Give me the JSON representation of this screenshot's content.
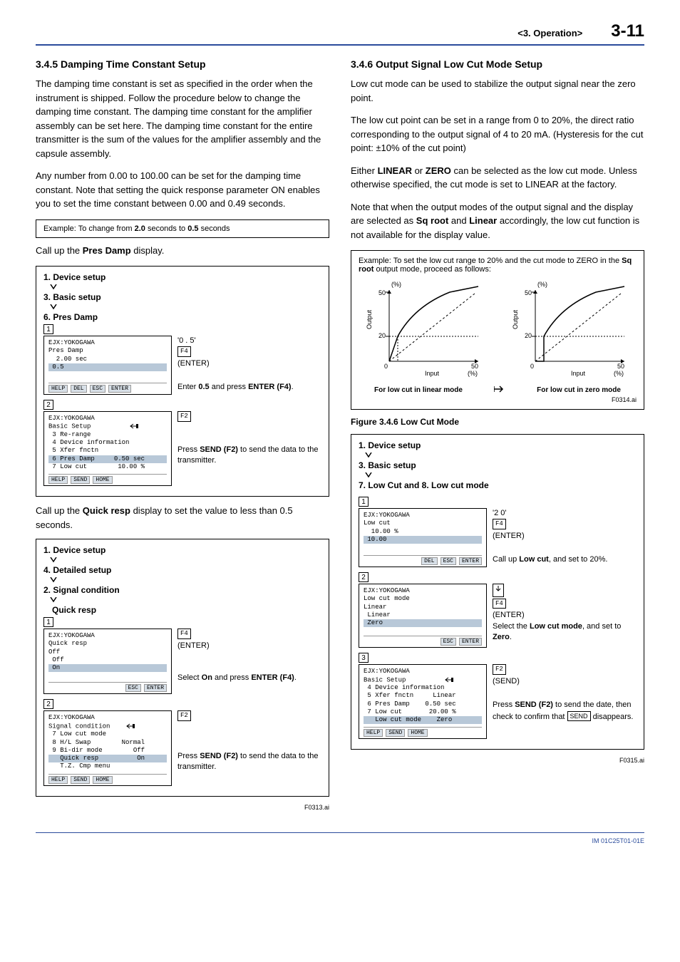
{
  "header": {
    "section": "<3.  Operation>",
    "page": "3-11"
  },
  "left": {
    "h345": "3.4.5   Damping Time Constant Setup",
    "p1": "The damping time constant is set as specified in the order when the instrument is shipped. Follow the procedure below to change the damping time constant. The damping time constant for the amplifier assembly can be set here. The damping time constant for the entire transmitter is the sum of the values for the amplifier assembly and the capsule assembly.",
    "p2": "Any number from 0.00 to 100.00 can be set for the damping time constant. Note that setting the quick response parameter ON enables you to set the time constant between 0.00 and 0.49 seconds.",
    "ex1_pre": "Example:  To change from ",
    "ex1_b1": "2.0",
    "ex1_mid": " seconds to ",
    "ex1_b2": "0.5",
    "ex1_post": " seconds",
    "callup1_a": "Call up the ",
    "callup1_b": "Pres Damp",
    "callup1_c": " display.",
    "menu1_1": "1. Device setup",
    "menu1_2": "3. Basic setup",
    "menu1_3": "6. Pres Damp",
    "t1_l1": "EJX:YOKOGAWA",
    "t1_l2": "Pres Damp",
    "t1_l3": "  2.00 sec",
    "t1_l4": " 0.5",
    "tb_help": "HELP",
    "tb_del": "DEL",
    "tb_esc": "ESC",
    "tb_enter": "ENTER",
    "ins1_val": "'0 . 5'",
    "ins1_key": "F4",
    "ins1_enter": "(ENTER)",
    "ins1_txt_a": "Enter ",
    "ins1_txt_b": "0.5",
    "ins1_txt_c": " and press ",
    "ins1_txt_d": "ENTER (F4)",
    "ins1_txt_e": ".",
    "t2_l1": "EJX:YOKOGAWA",
    "t2_l2": "Basic Setup",
    "t2_l3": " 3 Re-range",
    "t2_l4": " 4 Device information",
    "t2_l5": " 5 Xfer fnctn",
    "t2_l6": " 6 Pres Damp     0.50 sec",
    "t2_l7": " 7 Low cut        10.00 %",
    "tb_send": "SEND",
    "tb_home": "HOME",
    "ins2_key": "F2",
    "ins2_txt_a": "Press ",
    "ins2_txt_b": "SEND (F2)",
    "ins2_txt_c": " to send the data to the transmitter.",
    "callup2_a": "Call up the ",
    "callup2_b": "Quick resp",
    "callup2_c": " display to set the value to less than 0.5 seconds.",
    "menu2_1": "1. Device setup",
    "menu2_2": "4. Detailed setup",
    "menu2_3": "2. Signal condition",
    "menu2_4": "Quick resp",
    "t3_l1": "EJX:YOKOGAWA",
    "t3_l2": "Quick resp",
    "t3_l3": "Off",
    "t3_l4": " Off",
    "t3_l5": " On",
    "ins3_key": "F4",
    "ins3_enter": "(ENTER)",
    "ins3_txt_a": "Select ",
    "ins3_txt_b": "On",
    "ins3_txt_c": " and press ",
    "ins3_txt_d": "ENTER (F4)",
    "ins3_txt_e": ".",
    "t4_l1": "EJX:YOKOGAWA",
    "t4_l2": "Signal condition",
    "t4_l3": " 7 Low cut mode",
    "t4_l4": " 8 H/L Swap        Normal",
    "t4_l5": " 9 Bi-dir mode        Off",
    "t4_l6": "   Quick resp          On",
    "t4_l7": "   T.Z. Cmp menu",
    "fig1": "F0313.ai"
  },
  "right": {
    "h346": "3.4.6   Output Signal Low Cut Mode Setup",
    "p1": "Low cut mode can be used to stabilize the output signal near the zero point.",
    "p2": "The low cut point can be set in a range from 0 to 20%, the direct ratio corresponding to the output signal of 4 to 20 mA. (Hysteresis for the cut point: ±10% of the cut point)",
    "p3a": "Either ",
    "p3b": "LINEAR",
    "p3c": " or ",
    "p3d": "ZERO",
    "p3e": " can be selected as the low cut mode. Unless otherwise specified, the cut mode is set to LINEAR at the factory.",
    "p4a": "Note that when the output modes of the output signal and the display are selected as ",
    "p4b": "Sq root",
    "p4c": " and ",
    "p4d": "Linear",
    "p4e": " accordingly, the low cut function is not available for the display value.",
    "ex_a": "Example:  To set the low cut range to 20% and the cut mode to ZERO in the ",
    "ex_b": "Sq root",
    "ex_c": " output mode, proceed as follows:",
    "cap_lin": "For low cut in linear mode",
    "cap_zero": "For low cut in zero mode",
    "fig_ai": "F0314.ai",
    "figcap": "Figure 3.4.6    Low Cut Mode",
    "menu_1": "1. Device setup",
    "menu_2": "3. Basic setup",
    "menu_3": "7. Low Cut and 8. Low cut mode",
    "t1_l1": "EJX:YOKOGAWA",
    "t1_l2": "Low cut",
    "t1_l3": "  10.00 %",
    "t1_l4": " 10.00",
    "ins1_val": "'2 0'",
    "ins1_key": "F4",
    "ins1_enter": "(ENTER)",
    "ins1_txt_a": "Call up ",
    "ins1_txt_b": "Low cut",
    "ins1_txt_c": ", and set to 20%.",
    "t2_l1": "EJX:YOKOGAWA",
    "t2_l2": "Low cut mode",
    "t2_l3": "Linear",
    "t2_l4": " Linear",
    "t2_l5": " Zero",
    "ins2_key": "F4",
    "ins2_enter": "(ENTER)",
    "ins2_txt_a": "Select the ",
    "ins2_txt_b": "Low cut mode",
    "ins2_txt_c": ", and set to ",
    "ins2_txt_d": "Zero",
    "ins2_txt_e": ".",
    "t3_l1": "EJX:YOKOGAWA",
    "t3_l2": "Basic Setup",
    "t3_l3": " 4 Device information",
    "t3_l4": " 5 Xfer fnctn     Linear",
    "t3_l5": " 6 Pres Damp    0.50 sec",
    "t3_l6": " 7 Low cut       20.00 %",
    "t3_l7": "   Low cut mode    Zero",
    "ins3_key": "F2",
    "ins3_send": "(SEND)",
    "ins3_txt_a": "Press ",
    "ins3_txt_b": "SEND (F2)",
    "ins3_txt_c": " to send the date, then check to confirm that ",
    "ins3_txt_d": "SEND",
    "ins3_txt_e": " disappears.",
    "fig2": "F0315.ai"
  },
  "footer": "IM 01C25T01-01E",
  "chart_data": [
    {
      "type": "line",
      "title": "For low cut in linear mode",
      "xlabel": "Input",
      "ylabel": "Output",
      "x_unit": "(%)",
      "y_unit": "(%)",
      "xlim": [
        0,
        50
      ],
      "ylim": [
        0,
        50
      ],
      "x_ticks": [
        0,
        50
      ],
      "y_ticks": [
        0,
        20,
        50
      ],
      "low_cut_threshold_x": 4,
      "series": [
        {
          "name": "sqrt-output",
          "style": "solid",
          "points": [
            [
              0,
              0
            ],
            [
              4,
              20
            ],
            [
              10,
              31.6
            ],
            [
              20,
              44.7
            ],
            [
              30,
              50
            ]
          ]
        },
        {
          "name": "linear-ref",
          "style": "dashed",
          "points": [
            [
              0,
              0
            ],
            [
              50,
              50
            ]
          ]
        }
      ]
    },
    {
      "type": "line",
      "title": "For low cut in zero mode",
      "xlabel": "Input",
      "ylabel": "Output",
      "x_unit": "(%)",
      "y_unit": "(%)",
      "xlim": [
        0,
        50
      ],
      "ylim": [
        0,
        50
      ],
      "x_ticks": [
        0,
        50
      ],
      "y_ticks": [
        0,
        20,
        50
      ],
      "low_cut_threshold_x": 4,
      "series": [
        {
          "name": "sqrt-output",
          "style": "solid",
          "points": [
            [
              0,
              0
            ],
            [
              4,
              0
            ],
            [
              4,
              20
            ],
            [
              10,
              31.6
            ],
            [
              20,
              44.7
            ],
            [
              30,
              50
            ]
          ]
        },
        {
          "name": "linear-ref",
          "style": "dashed",
          "points": [
            [
              0,
              0
            ],
            [
              50,
              50
            ]
          ]
        }
      ]
    }
  ]
}
